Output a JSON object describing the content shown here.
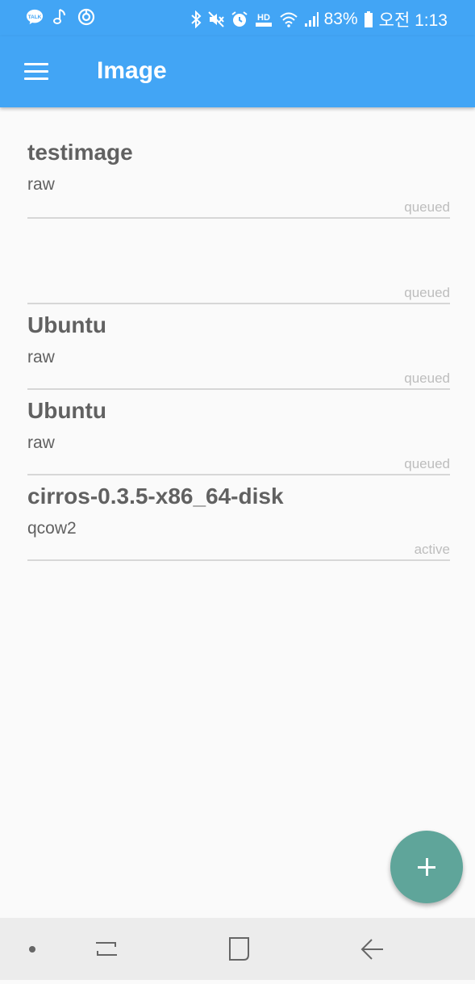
{
  "status_bar": {
    "battery": "83%",
    "time": "오전 1:13",
    "icons": [
      "talk-icon",
      "music-icon",
      "sync-icon",
      "bluetooth-icon",
      "mute-icon",
      "alarm-icon",
      "hd-voice-icon",
      "wifi-icon",
      "signal-icon",
      "battery-icon"
    ],
    "hd_label": "HD",
    "talk_label": "TALK"
  },
  "app_bar": {
    "title": "Image",
    "menu_icon": "hamburger-menu-icon"
  },
  "images": [
    {
      "name": "testimage",
      "format": "raw",
      "status": "queued"
    },
    {
      "name": "",
      "format": "",
      "status": "queued"
    },
    {
      "name": "Ubuntu",
      "format": "raw",
      "status": "queued"
    },
    {
      "name": "Ubuntu",
      "format": "raw",
      "status": "queued"
    },
    {
      "name": "cirros-0.3.5-x86_64-disk",
      "format": "qcow2",
      "status": "active"
    }
  ],
  "fab": {
    "icon": "plus-icon"
  },
  "nav_bar": {
    "icons": [
      "nav-dot-icon",
      "recent-apps-icon",
      "home-icon",
      "back-icon"
    ]
  },
  "colors": {
    "primary": "#42a5f5",
    "fab": "#5fa59a",
    "text": "#616161",
    "status_text": "#bdbdbd"
  }
}
